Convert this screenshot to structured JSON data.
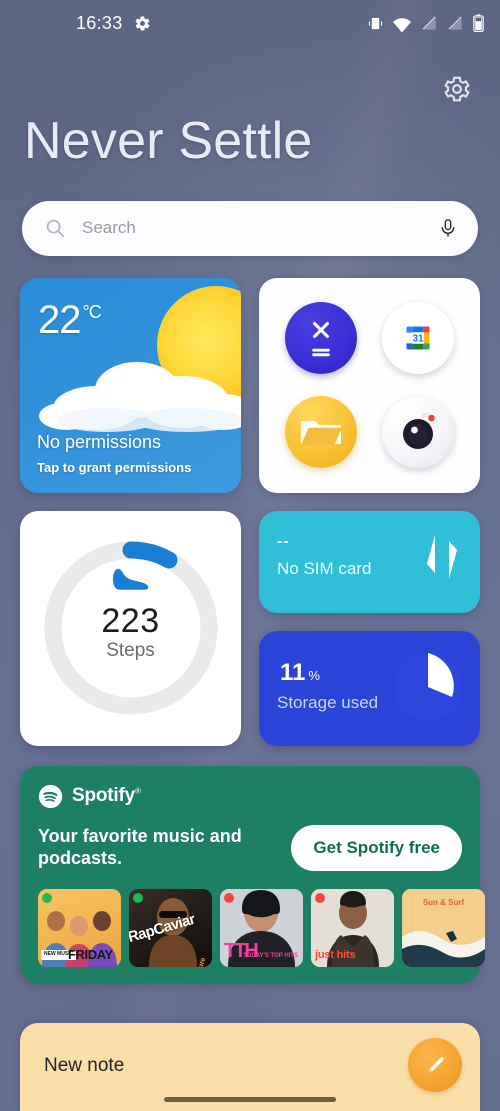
{
  "statusbar": {
    "time": "16:33",
    "gear_icon": "gear-icon",
    "icons": [
      "vibrate-icon",
      "wifi-icon",
      "signal-off-icon",
      "signal-off-2-icon",
      "battery-icon"
    ]
  },
  "header": {
    "settings_icon": "gear-icon",
    "title": "Never Settle"
  },
  "search": {
    "placeholder": "Search",
    "search_icon": "search-icon",
    "mic_icon": "microphone-icon"
  },
  "weather": {
    "temperature": "22",
    "unit": "°C",
    "status": "No permissions",
    "action": "Tap to grant permissions",
    "bg_color": "#2f90da"
  },
  "apps": {
    "items": [
      {
        "name": "Calculator",
        "icon": "calculator-icon",
        "color": "#3b2fd6"
      },
      {
        "name": "Calendar",
        "icon": "calendar-icon",
        "day": "31"
      },
      {
        "name": "Files",
        "icon": "folder-icon",
        "color": "#f9c538"
      },
      {
        "name": "Camera",
        "icon": "camera-icon"
      }
    ]
  },
  "steps": {
    "count": "223",
    "label": "Steps",
    "icon": "shoe-icon",
    "progress_color": "#1a7fd4",
    "progress_pct": 9
  },
  "sim": {
    "value": "--",
    "label": "No SIM card",
    "icon": "data-transfer-icon",
    "bg_color": "#2fc0d8"
  },
  "storage": {
    "value": "11",
    "unit": "%",
    "label": "Storage used",
    "icon": "pie-chart-icon",
    "percent": 11,
    "bg_color": "#2b44d8"
  },
  "spotify": {
    "brand": "Spotify",
    "trademark": "®",
    "logo_icon": "spotify-logo-icon",
    "tagline": "Your favorite music and podcasts.",
    "cta_label": "Get Spotify free",
    "bg_color": "#1d7f63",
    "covers": [
      {
        "title": "FRIDAY",
        "sub": "NEW MUSIC",
        "name": "new-music-friday"
      },
      {
        "title": "RapCaviar",
        "sub": "ft. Future",
        "name": "rapcaviar"
      },
      {
        "title": "TTH",
        "sub": "TODAY'S TOP HITS",
        "name": "todays-top-hits"
      },
      {
        "title": "just hits",
        "sub": "",
        "name": "just-hits"
      },
      {
        "title": "Sun & Surf",
        "sub": "",
        "name": "sun-and-surf"
      }
    ]
  },
  "note": {
    "label": "New note",
    "fab_icon": "pencil-icon",
    "bg_color": "#fbdfa8"
  }
}
